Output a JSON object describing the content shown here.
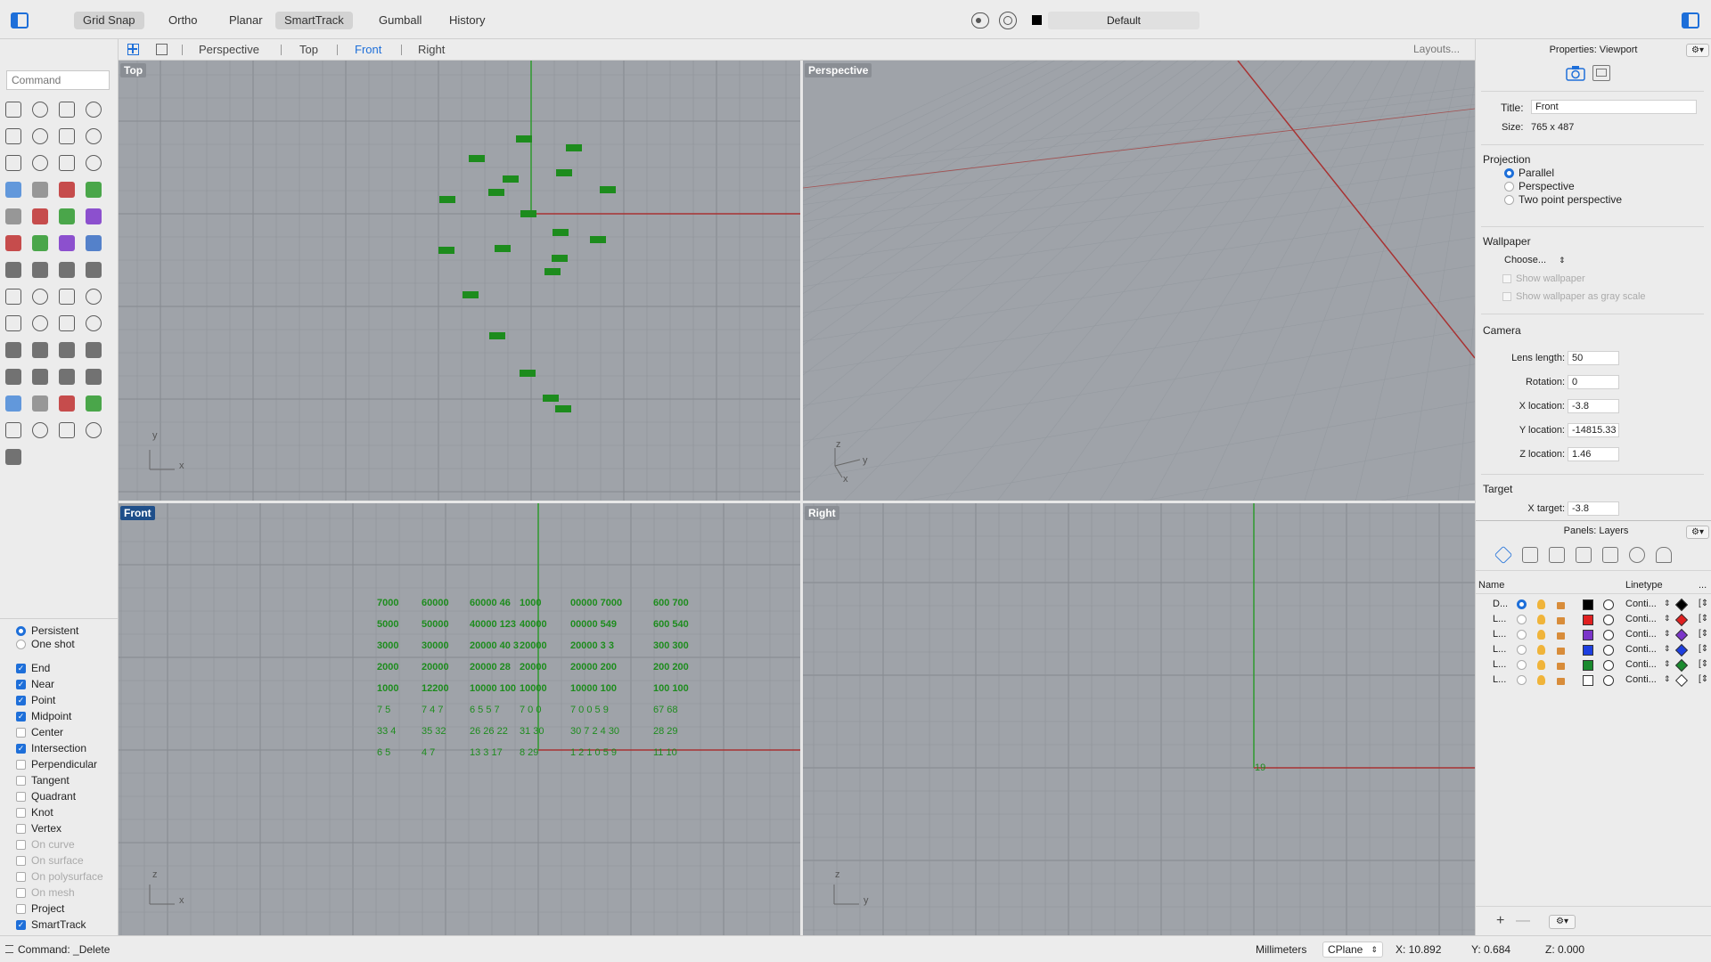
{
  "toolbar": {
    "buttons": [
      {
        "label": "Grid Snap",
        "active": true
      },
      {
        "label": "Ortho",
        "active": false
      },
      {
        "label": "Planar",
        "active": false
      },
      {
        "label": "SmartTrack",
        "active": true
      },
      {
        "label": "Gumball",
        "active": false
      },
      {
        "label": "History",
        "active": false
      }
    ],
    "layer_name": "Default"
  },
  "viewport_tabs": [
    "Perspective",
    "Top",
    "Front",
    "Right"
  ],
  "active_tab": "Front",
  "layouts_label": "Layouts...",
  "command": {
    "placeholder": "Command"
  },
  "snaps": {
    "persistent": "Persistent",
    "one_shot": "One shot",
    "items": [
      {
        "label": "End",
        "checked": true,
        "disabled": false
      },
      {
        "label": "Near",
        "checked": true,
        "disabled": false
      },
      {
        "label": "Point",
        "checked": true,
        "disabled": false
      },
      {
        "label": "Midpoint",
        "checked": true,
        "disabled": false
      },
      {
        "label": "Center",
        "checked": false,
        "disabled": false
      },
      {
        "label": "Intersection",
        "checked": true,
        "disabled": false
      },
      {
        "label": "Perpendicular",
        "checked": false,
        "disabled": false
      },
      {
        "label": "Tangent",
        "checked": false,
        "disabled": false
      },
      {
        "label": "Quadrant",
        "checked": false,
        "disabled": false
      },
      {
        "label": "Knot",
        "checked": false,
        "disabled": false
      },
      {
        "label": "Vertex",
        "checked": false,
        "disabled": false
      },
      {
        "label": "On curve",
        "checked": false,
        "disabled": true
      },
      {
        "label": "On surface",
        "checked": false,
        "disabled": true
      },
      {
        "label": "On polysurface",
        "checked": false,
        "disabled": true
      },
      {
        "label": "On mesh",
        "checked": false,
        "disabled": true
      },
      {
        "label": "Project",
        "checked": false,
        "disabled": false
      },
      {
        "label": "SmartTrack",
        "checked": true,
        "disabled": false
      }
    ]
  },
  "viewports": {
    "top": {
      "label": "Top",
      "axis_a": "y",
      "axis_b": "x"
    },
    "perspective": {
      "label": "Perspective",
      "axis_a": "z",
      "axis_b": "y",
      "axis_c": "x"
    },
    "front": {
      "label": "Front",
      "axis_a": "z",
      "axis_b": "x"
    },
    "right": {
      "label": "Right",
      "axis_a": "z",
      "axis_b": "y",
      "marker": "19"
    }
  },
  "front_labels": [
    [
      "7000",
      "60000",
      "60000 46",
      "1000",
      "00000 7000",
      "600 700"
    ],
    [
      "5000",
      "50000",
      "40000 123",
      "40000",
      "00000 549",
      "600 540"
    ],
    [
      "3000",
      "30000",
      "20000 40 3",
      "20000",
      "20000 3 3",
      "300 300"
    ],
    [
      "2000",
      "20000",
      "20000 28",
      "20000",
      "20000 200",
      "200 200"
    ],
    [
      "1000",
      "12200",
      "10000 100",
      "10000",
      "10000 100",
      "100 100"
    ],
    [
      "7 5",
      "7 4 7",
      "6 5 5 7",
      "7 0 0",
      "7 0 0 5 9",
      "67 68"
    ],
    [
      "33 4",
      "35 32",
      "26 26 22",
      "31 30",
      "30 7 2 4 30",
      "28 29"
    ],
    [
      "6 5",
      "4 7",
      "13 3 17",
      "8 29",
      "1 2 1 0 5 9",
      "11 10"
    ]
  ],
  "properties": {
    "header": "Properties: Viewport",
    "title_label": "Title:",
    "title_value": "Front",
    "size_label": "Size:",
    "size_value": "765 x 487",
    "projection_label": "Projection",
    "projection_options": [
      "Parallel",
      "Perspective",
      "Two point perspective"
    ],
    "projection_selected": "Parallel",
    "wallpaper_label": "Wallpaper",
    "wallpaper_choose": "Choose...",
    "show_wallpaper": "Show wallpaper",
    "show_wallpaper_gray": "Show wallpaper as gray scale",
    "camera_label": "Camera",
    "camera_fields": [
      {
        "label": "Lens length:",
        "value": "50"
      },
      {
        "label": "Rotation:",
        "value": "0"
      },
      {
        "label": "X location:",
        "value": "-3.8"
      },
      {
        "label": "Y location:",
        "value": "-14815.33"
      },
      {
        "label": "Z location:",
        "value": "1.46"
      }
    ],
    "target_label": "Target",
    "target_fields": [
      {
        "label": "X target:",
        "value": "-3.8"
      }
    ]
  },
  "layers": {
    "header": "Panels: Layers",
    "col_name": "Name",
    "col_linetype": "Linetype",
    "col_more": "...",
    "rows": [
      {
        "name": "D...",
        "current": true,
        "color": "#000000",
        "linetype": "Conti...",
        "swatch": "#000000"
      },
      {
        "name": "L...",
        "current": false,
        "color": "#e02020",
        "linetype": "Conti...",
        "swatch": "#e02020"
      },
      {
        "name": "L...",
        "current": false,
        "color": "#7b35c9",
        "linetype": "Conti...",
        "swatch": "#7b35c9"
      },
      {
        "name": "L...",
        "current": false,
        "color": "#1d3fe0",
        "linetype": "Conti...",
        "swatch": "#1d3fe0"
      },
      {
        "name": "L...",
        "current": false,
        "color": "#1a8a2e",
        "linetype": "Conti...",
        "swatch": "#1a8a2e"
      },
      {
        "name": "L...",
        "current": false,
        "color": "#ffffff",
        "linetype": "Conti...",
        "swatch": "#ffffff"
      }
    ]
  },
  "status": {
    "command": "Command: _Delete",
    "units": "Millimeters",
    "cplane": "CPlane",
    "x": "X: 10.892",
    "y": "Y: 0.684",
    "z": "Z: 0.000"
  },
  "colors": {
    "accent": "#1e6fd9",
    "viewport_bg": "#9fa3a9",
    "grid": "#8f9399",
    "x_axis": "#a83232",
    "y_axis": "#2e9a2e",
    "object_green": "#1d8c1d"
  }
}
